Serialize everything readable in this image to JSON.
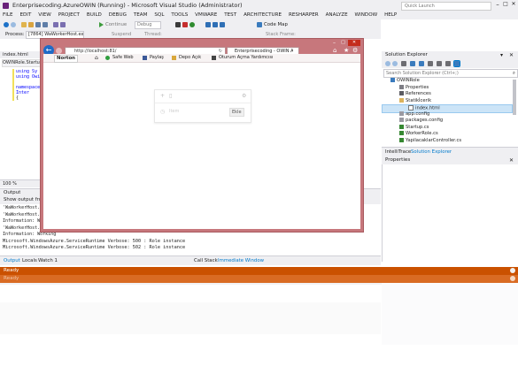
{
  "window": {
    "title": "Enterprisecoding.AzureOWIN (Running) - Microsoft Visual Studio (Administrator)",
    "quick_launch": "Quick Launch"
  },
  "menu": [
    "FILE",
    "EDIT",
    "VIEW",
    "PROJECT",
    "BUILD",
    "DEBUG",
    "TEAM",
    "SQL",
    "TOOLS",
    "VMWARE",
    "TEST",
    "ARCHITECTURE",
    "RESHARPER",
    "ANALYZE",
    "WINDOW",
    "HELP"
  ],
  "toolbar": {
    "continue_label": "Continue",
    "config": "Debug",
    "code_map": "Code Map",
    "process_label": "Process:",
    "process_value": "[7864] WaWorkerHost.exe",
    "suspend_label": "Suspend",
    "thread_label": "Thread:",
    "stack_frame_label": "Stack Frame:"
  },
  "editor": {
    "tab": "index.html",
    "subtab": "OWINRole.Startup",
    "lines": [
      "using Sy",
      "using Owi",
      "",
      "namespace",
      "  Inter",
      "  {"
    ],
    "zoom": "100 %"
  },
  "browser": {
    "url": "http://localhost:81/",
    "tab_title": "Enterprisecoding - OWIN A...",
    "favorites": [
      "Norton",
      "Safe Web",
      "Paylaş",
      "Depo Açık",
      "Oturum Açma Yardımcısı"
    ],
    "widget_placeholder": "Item",
    "widget_button": "Ekle"
  },
  "output": {
    "title": "Output",
    "show_from_label": "Show output from:",
    "lines": [
      "'WaWorkerHost.exe' (CLR v4.0.30319: WaWorkerHost.exe): Loaded",
      "'WaWorkerHost.exe' (CLR v4.0.30319: WaWorkerHost.exe): Loaded",
      "Information: Working",
      "'WaWorkerHost.exe' (CLR v4.0.30319: WaWorkerHost.exe): Loaded",
      "Information: Working",
      "Microsoft.WindowsAzure.ServiceRuntime Verbose: 500 : Role instance",
      "Microsoft.WindowsAzure.ServiceRuntime Verbose: 502 : Role instance"
    ],
    "tabs": [
      "Output",
      "Locals",
      "Watch 1"
    ],
    "right_tabs": [
      "Call Stack",
      "Immediate Window"
    ]
  },
  "solution_explorer": {
    "title": "Solution Explorer",
    "search_placeholder": "Search Solution Explorer (Ctrl+;)",
    "items": [
      {
        "label": "OWINRole",
        "indent": 0
      },
      {
        "label": "Properties",
        "indent": 1
      },
      {
        "label": "References",
        "indent": 1
      },
      {
        "label": "Statikİcerik",
        "indent": 1
      },
      {
        "label": "index.html",
        "indent": 2,
        "selected": true
      },
      {
        "label": "app.config",
        "indent": 1
      },
      {
        "label": "packages.config",
        "indent": 1
      },
      {
        "label": "Startup.cs",
        "indent": 1
      },
      {
        "label": "WorkerRole.cs",
        "indent": 1
      },
      {
        "label": "YapilacaklarController.cs",
        "indent": 1
      }
    ],
    "tabs": [
      "IntelliTrace",
      "Solution Explorer"
    ]
  },
  "properties": {
    "title": "Properties"
  },
  "status": {
    "text": "Ready",
    "ghost": "Ready"
  },
  "colors": {
    "status": "#ca5100",
    "accent": "#007acc",
    "browser_frame": "#c7777c"
  }
}
